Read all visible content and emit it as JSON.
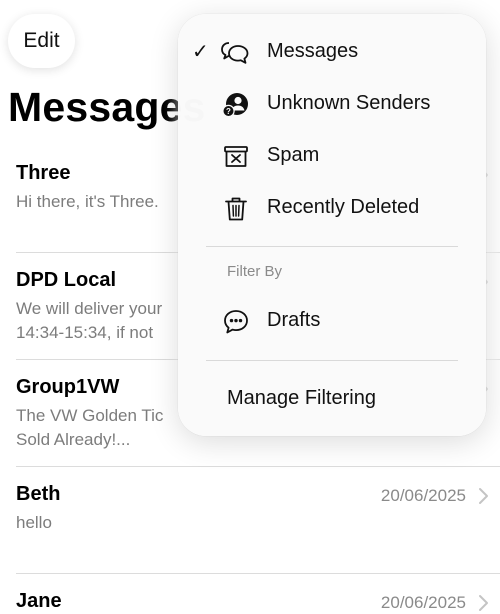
{
  "header": {
    "edit_label": "Edit",
    "title": "Messages"
  },
  "conversations": [
    {
      "name": "Three",
      "preview_lines": [
        "Hi there, it's Three."
      ],
      "date": ""
    },
    {
      "name": "DPD Local",
      "preview_lines": [
        "We will deliver your",
        "14:34-15:34, if not"
      ],
      "date": ""
    },
    {
      "name": "Group1VW",
      "preview_lines": [
        "The VW Golden Tic",
        "Sold Already!..."
      ],
      "date": ""
    },
    {
      "name": "Beth",
      "preview_lines": [
        "hello"
      ],
      "date": "20/06/2025"
    },
    {
      "name": "Jane",
      "preview_lines": [],
      "date": "20/06/2025"
    }
  ],
  "menu": {
    "items": [
      {
        "label": "Messages",
        "icon": "chat-bubbles-icon",
        "checked": true
      },
      {
        "label": "Unknown Senders",
        "icon": "unknown-person-icon",
        "checked": false
      },
      {
        "label": "Spam",
        "icon": "spam-box-icon",
        "checked": false
      },
      {
        "label": "Recently Deleted",
        "icon": "trash-icon",
        "checked": false
      }
    ],
    "check_glyph": "✓",
    "filter_heading": "Filter By",
    "filter_items": [
      {
        "label": "Drafts",
        "icon": "drafts-bubble-icon"
      }
    ],
    "manage_label": "Manage Filtering"
  },
  "colors": {
    "secondary_text": "#7c7c7c",
    "divider": "#dcdcdc",
    "menu_background": "#fafafa"
  }
}
